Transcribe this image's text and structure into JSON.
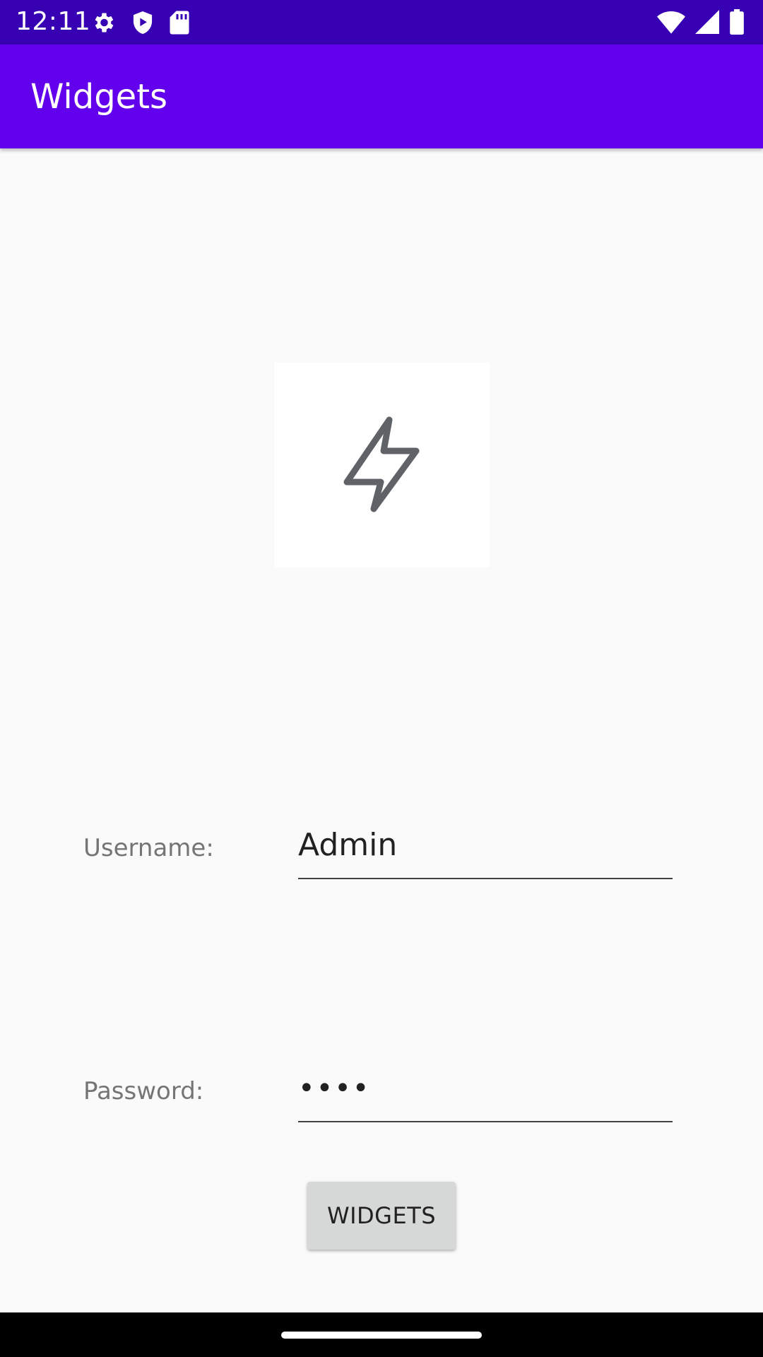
{
  "status_bar": {
    "time": "12:11",
    "left_icons": [
      "gear-icon",
      "shield-play-icon",
      "sd-card-icon"
    ],
    "right_icons": [
      "wifi-icon",
      "cellular-signal-icon",
      "battery-icon"
    ]
  },
  "app_bar": {
    "title": "Widgets"
  },
  "image": {
    "icon": "lightning-bolt-icon"
  },
  "form": {
    "username_label": "Username:",
    "username_value": "Admin",
    "password_label": "Password:",
    "password_value": "••••"
  },
  "action": {
    "button_label": "WIDGETS"
  },
  "colors": {
    "status_bar": "#3700b3",
    "app_bar": "#6200ee",
    "background": "#fafafa",
    "button": "#d6d7d7"
  }
}
